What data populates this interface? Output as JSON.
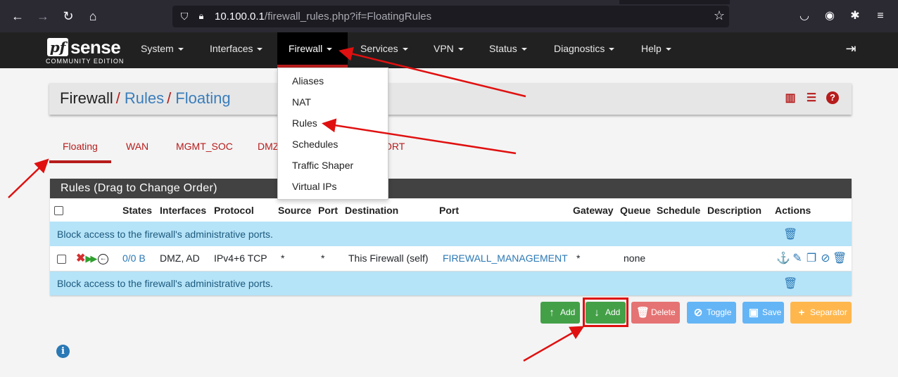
{
  "browser": {
    "url_host": "10.100.0.1",
    "url_path": "/firewall_rules.php?if=FloatingRules"
  },
  "navbar": {
    "logo_pf": "pf",
    "logo_sense": "sense",
    "logo_sub": "COMMUNITY EDITION",
    "menu": [
      "System",
      "Interfaces",
      "Firewall",
      "Services",
      "VPN",
      "Status",
      "Diagnostics",
      "Help"
    ]
  },
  "firewall_menu": [
    "Aliases",
    "NAT",
    "Rules",
    "Schedules",
    "Traffic Shaper",
    "Virtual IPs"
  ],
  "breadcrumb": {
    "root": "Firewall",
    "sep": "/",
    "level1": "Rules",
    "level2": "Floating"
  },
  "interface_tabs": [
    "Floating",
    "WAN",
    "MGMT_SOC",
    "DMZ",
    "ORT"
  ],
  "rules_panel": {
    "title": "Rules (Drag to Change Order)",
    "columns": [
      "States",
      "Interfaces",
      "Protocol",
      "Source",
      "Port",
      "Destination",
      "Port",
      "Gateway",
      "Queue",
      "Schedule",
      "Description",
      "Actions"
    ],
    "separator_text": "Block access to the firewall's administrative ports.",
    "row": {
      "states": "0/0 B",
      "interfaces": "DMZ, AD",
      "protocol": "IPv4+6 TCP",
      "source": "*",
      "source_port": "*",
      "destination": "This Firewall (self)",
      "dest_port": "FIREWALL_MANAGEMENT",
      "gateway": "*",
      "queue": "none",
      "schedule": "",
      "description": ""
    }
  },
  "buttons": {
    "add_top": "Add",
    "add_bottom": "Add",
    "delete": "Delete",
    "toggle": "Toggle",
    "save": "Save",
    "separator": "Separator"
  },
  "colors": {
    "accent_red": "#b71c1c",
    "link_blue": "#3a7dbb",
    "separator_bg": "#b5e3f8",
    "annotation_red": "#e01010"
  }
}
